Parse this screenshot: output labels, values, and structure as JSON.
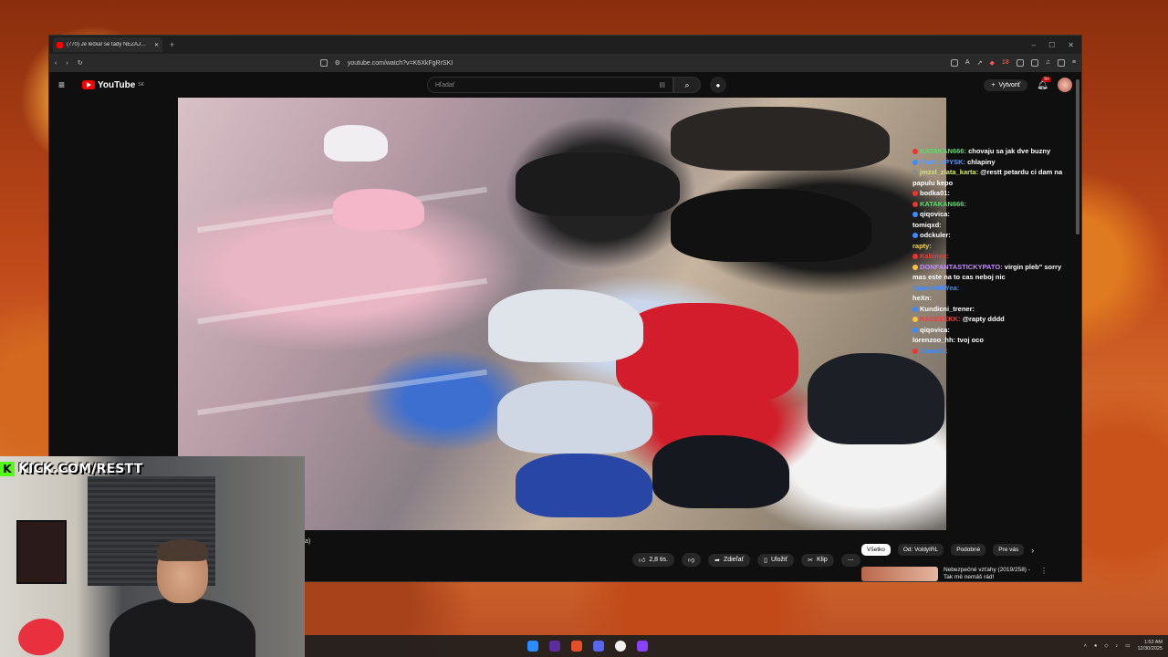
{
  "browser": {
    "tab_title": "(770) Je léčka! se tady NEZAJ…",
    "url": "youtube.com/watch?v=K6XkFgRrSKI",
    "ext_badge": "18"
  },
  "youtube": {
    "logo_text": "YouTube",
    "region": "SK",
    "search_placeholder": "Hľadať",
    "create_label": "Vytvoriť",
    "notif_count": "9+"
  },
  "chat": [
    {
      "user": "KATAKAN666:",
      "text": "chovaju sa jak dve buzny",
      "color": "#57e06c"
    },
    {
      "user": "PochvoPYSK:",
      "text": "chlapiny",
      "color": "#5a9bff"
    },
    {
      "user": "jmzsl_zlata_karta:",
      "text": "@restt petardu ci dam na papulu kepo",
      "color": "#cfe96b"
    },
    {
      "user": "bodka01:",
      "text": "",
      "color": "#ffffff"
    },
    {
      "user": "KATAKAN666:",
      "text": "",
      "color": "#57e06c"
    },
    {
      "user": "qiqovica:",
      "text": "",
      "color": "#ffffff"
    },
    {
      "user": "tomiqxd:",
      "text": "",
      "color": "#ffffff"
    },
    {
      "user": "odckuler:",
      "text": "",
      "color": "#ffffff"
    },
    {
      "user": "rapty:",
      "text": "",
      "color": "#f5d64a"
    },
    {
      "user": "Kabinex:",
      "text": "",
      "color": "#e0413b"
    },
    {
      "user": "DONFANTASTICKYPATO:",
      "text": "virgin pleb\" sorry mas este na to cas neboj nic",
      "color": "#c58cff"
    },
    {
      "user": "SpaceHellYea:",
      "text": "",
      "color": "#3c8cff"
    },
    {
      "user": "heXn:",
      "text": "",
      "color": "#ffffff"
    },
    {
      "user": "Kundicni_trener:",
      "text": "",
      "color": "#ffffff"
    },
    {
      "user": "RADEEEKK:",
      "text": "@rapty dddd",
      "color": "#ff3b3b"
    },
    {
      "user": "qiqovica:",
      "text": "",
      "color": "#ffffff"
    },
    {
      "user": "lorenzoo_hh:",
      "text": "tvoj oco",
      "color": "#ffffff"
    },
    {
      "user": "Slavo30:",
      "text": "",
      "color": "#3c8cff"
    }
  ],
  "actions": {
    "likes": "2,8 tis.",
    "share": "Zdieľať",
    "save": "Uložiť",
    "clip": "Klip"
  },
  "chips": [
    "Všetko",
    "Od: VoldyIRL",
    "Podobné",
    "Pre vás"
  ],
  "recommendation": {
    "title": "Nebezpečné vzťahy (2019/258) - Tak mě nemáš rád!"
  },
  "overlay": {
    "kick_text": "KICK.COM/RESTT",
    "partial_text": "a)"
  },
  "taskbar": {
    "time": "1:52 AM",
    "date": "12/30/2025"
  }
}
